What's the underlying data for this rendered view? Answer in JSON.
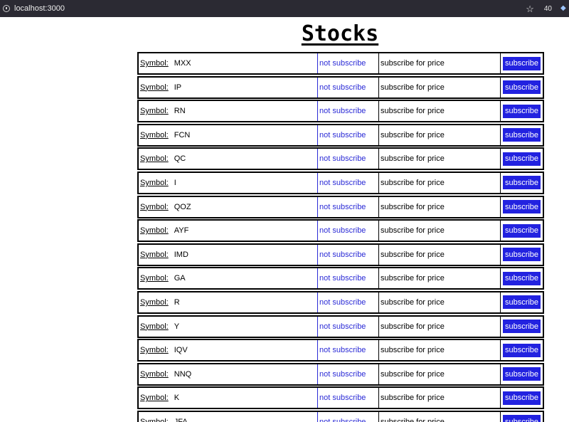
{
  "browser": {
    "url": "localhost:3000",
    "extension_count": "40",
    "bookmark_icon": "star-icon",
    "site_icon": "info-circle-icon"
  },
  "page": {
    "title": "Stocks"
  },
  "colors": {
    "accent": "#2222e0",
    "status_text": "#2b2bd6",
    "border": "#000000"
  },
  "stocks": [
    {
      "symbol_label": "Symbol:",
      "symbol": "MXX",
      "status": "not subscribe",
      "price": "subscribe for price",
      "action": "subscribe"
    },
    {
      "symbol_label": "Symbol:",
      "symbol": "IP",
      "status": "not subscribe",
      "price": "subscribe for price",
      "action": "subscribe"
    },
    {
      "symbol_label": "Symbol:",
      "symbol": "RN",
      "status": "not subscribe",
      "price": "subscribe for price",
      "action": "subscribe"
    },
    {
      "symbol_label": "Symbol:",
      "symbol": "FCN",
      "status": "not subscribe",
      "price": "subscribe for price",
      "action": "subscribe"
    },
    {
      "symbol_label": "Symbol:",
      "symbol": "QC",
      "status": "not subscribe",
      "price": "subscribe for price",
      "action": "subscribe"
    },
    {
      "symbol_label": "Symbol:",
      "symbol": "I",
      "status": "not subscribe",
      "price": "subscribe for price",
      "action": "subscribe"
    },
    {
      "symbol_label": "Symbol:",
      "symbol": "QOZ",
      "status": "not subscribe",
      "price": "subscribe for price",
      "action": "subscribe"
    },
    {
      "symbol_label": "Symbol:",
      "symbol": "AYF",
      "status": "not subscribe",
      "price": "subscribe for price",
      "action": "subscribe"
    },
    {
      "symbol_label": "Symbol:",
      "symbol": "IMD",
      "status": "not subscribe",
      "price": "subscribe for price",
      "action": "subscribe"
    },
    {
      "symbol_label": "Symbol:",
      "symbol": "GA",
      "status": "not subscribe",
      "price": "subscribe for price",
      "action": "subscribe"
    },
    {
      "symbol_label": "Symbol:",
      "symbol": "R",
      "status": "not subscribe",
      "price": "subscribe for price",
      "action": "subscribe"
    },
    {
      "symbol_label": "Symbol:",
      "symbol": "Y",
      "status": "not subscribe",
      "price": "subscribe for price",
      "action": "subscribe"
    },
    {
      "symbol_label": "Symbol:",
      "symbol": "IQV",
      "status": "not subscribe",
      "price": "subscribe for price",
      "action": "subscribe"
    },
    {
      "symbol_label": "Symbol:",
      "symbol": "NNQ",
      "status": "not subscribe",
      "price": "subscribe for price",
      "action": "subscribe"
    },
    {
      "symbol_label": "Symbol:",
      "symbol": "K",
      "status": "not subscribe",
      "price": "subscribe for price",
      "action": "subscribe"
    },
    {
      "symbol_label": "Symbol:",
      "symbol": "JFA",
      "status": "not subscribe",
      "price": "subscribe for price",
      "action": "subscribe"
    }
  ]
}
